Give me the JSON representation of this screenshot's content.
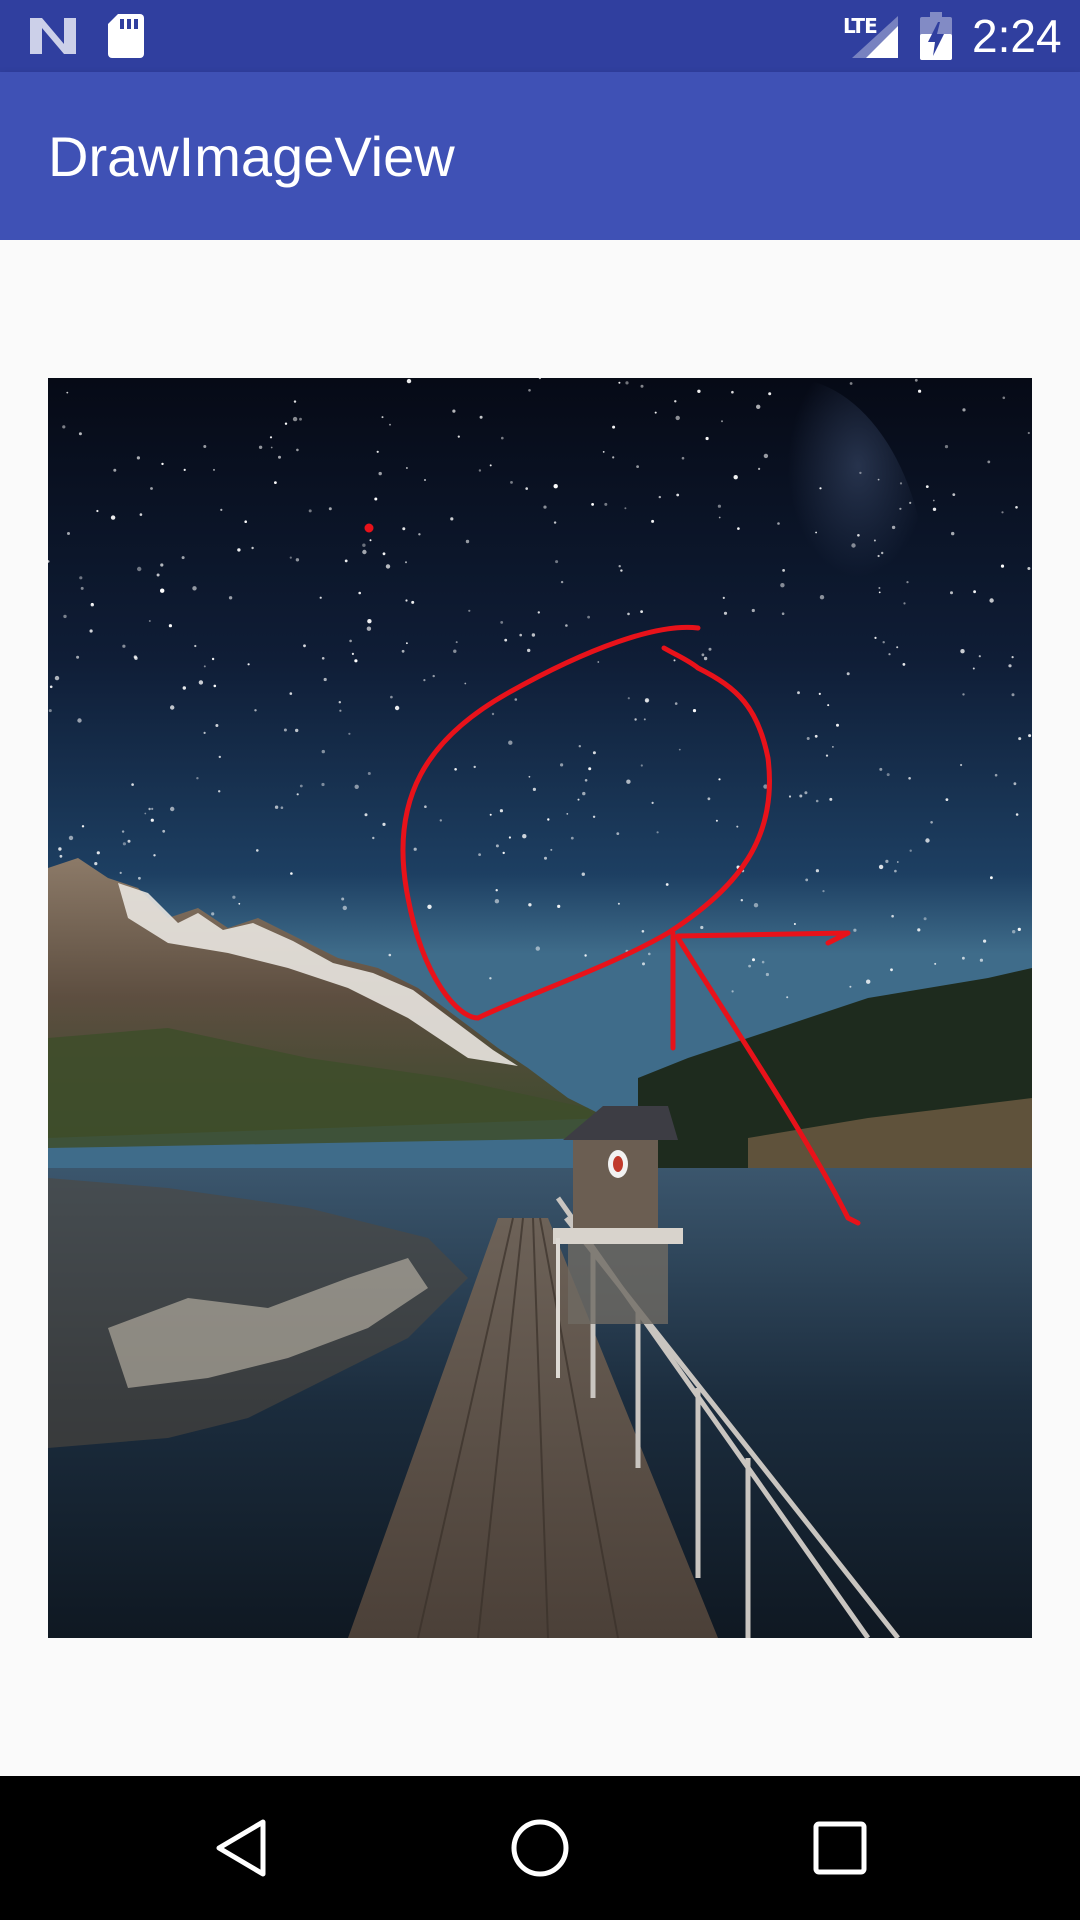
{
  "status_bar": {
    "time": "2:24",
    "network_label": "LTE",
    "icons": [
      "android-n-icon",
      "sd-card-icon",
      "lte-signal-icon",
      "battery-charging-icon"
    ]
  },
  "app_bar": {
    "title": "DrawImageView"
  },
  "image": {
    "subject": "night sky over mountain lake with wooden pier and boathouse",
    "annotation_color": "#e8121a"
  },
  "nav_bar": {
    "icons": [
      "back-icon",
      "home-icon",
      "recents-icon"
    ]
  },
  "colors": {
    "status_bar": "#303f9f",
    "app_bar": "#3f51b5",
    "background": "#fafafa",
    "nav_bar": "#000000"
  }
}
